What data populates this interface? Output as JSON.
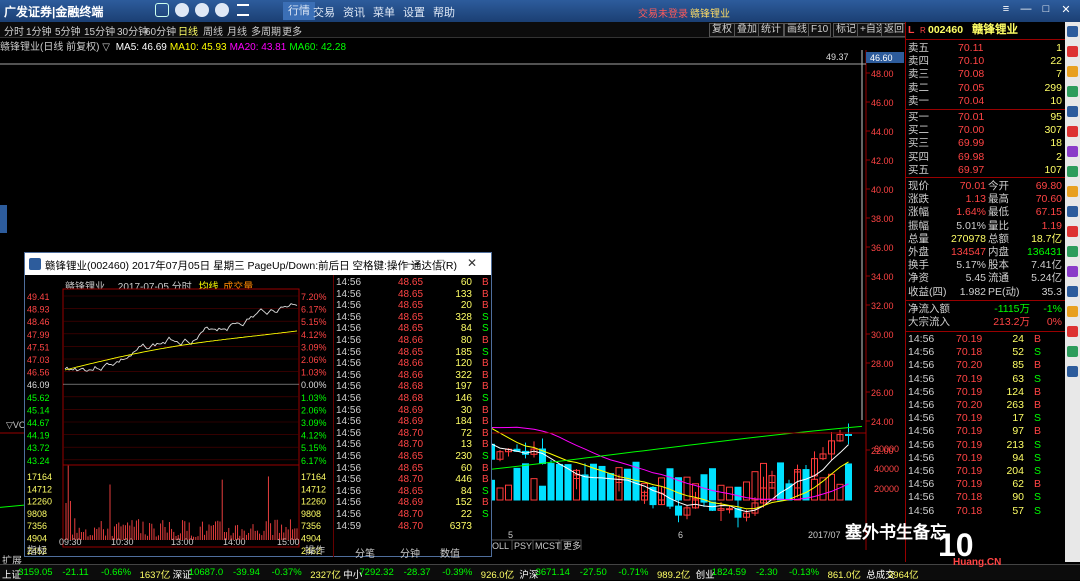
{
  "topbar": {
    "brand": "广发证券|金融终端",
    "nav": [
      "行情",
      "交易",
      "资讯",
      "菜单",
      "设置",
      "帮助"
    ],
    "nav_selected": 0,
    "trade_status": "交易未登录",
    "stock_title": "赣锋锂业"
  },
  "toolbar": {
    "periods": [
      "分时",
      "1分钟",
      "5分钟",
      "15分钟",
      "30分钟",
      "60分钟",
      "日线",
      "周线",
      "月线",
      "多周期",
      "更多"
    ],
    "period_selected": 6,
    "right_buttons": [
      "复权",
      "叠加",
      "统计",
      "画线",
      "F10",
      "标记",
      "+自选",
      "返回"
    ]
  },
  "chart_info": {
    "name": "赣锋锂业(日线 前复权)",
    "ma_items": [
      {
        "label": "MA5: 46.69",
        "color": "#ffffff"
      },
      {
        "label": "MA10: 45.93",
        "color": "#ffff00"
      },
      {
        "label": "MA20: 43.81",
        "color": "#ff00ff"
      },
      {
        "label": "MA60: 42.28",
        "color": "#00ff00"
      }
    ]
  },
  "main_chart": {
    "y_labels": [
      "48.00",
      "46.00",
      "44.00",
      "42.00",
      "40.00",
      "38.00",
      "36.00",
      "34.00",
      "32.00",
      "30.00",
      "28.00",
      "26.00",
      "24.00",
      "22.00"
    ],
    "high_label": "49.37",
    "price_marker": "46.60",
    "vol_labels": [
      "60000",
      "40000",
      "20000"
    ],
    "vol_label": "VOL",
    "date_labels": [
      "5",
      "6",
      "2017/07"
    ],
    "bottom_tabs": [
      "OLL",
      "PSY",
      "MCST",
      "更多"
    ],
    "colors": {
      "up": "#ff3b3b",
      "down": "#00e0ff",
      "ma5": "#ffffff",
      "ma10": "#ffff00",
      "ma20": "#ff00ff",
      "ma60": "#00ff00"
    }
  },
  "left_labels": [
    "扩展"
  ],
  "quote": {
    "code": "002460",
    "name": "赣锋锂业",
    "asks": [
      {
        "label": "卖五",
        "price": "70.11",
        "vol": "1"
      },
      {
        "label": "卖四",
        "price": "70.10",
        "vol": "22"
      },
      {
        "label": "卖三",
        "price": "70.08",
        "vol": "7"
      },
      {
        "label": "卖二",
        "price": "70.05",
        "vol": "299"
      },
      {
        "label": "卖一",
        "price": "70.04",
        "vol": "10"
      }
    ],
    "bids": [
      {
        "label": "买一",
        "price": "70.01",
        "vol": "95"
      },
      {
        "label": "买二",
        "price": "70.00",
        "vol": "307"
      },
      {
        "label": "买三",
        "price": "69.99",
        "vol": "18"
      },
      {
        "label": "买四",
        "price": "69.98",
        "vol": "2"
      },
      {
        "label": "买五",
        "price": "69.97",
        "vol": "107"
      }
    ],
    "stats": [
      {
        "l1": "现价",
        "v1": "70.01",
        "l2": "今开",
        "v2": "69.80"
      },
      {
        "l1": "涨跌",
        "v1": "1.13",
        "l2": "最高",
        "v2": "70.60"
      },
      {
        "l1": "涨幅",
        "v1": "1.64%",
        "l2": "最低",
        "v2": "67.15"
      },
      {
        "l1": "振幅",
        "v1": "5.01%",
        "l2": "量比",
        "v2": "1.19"
      },
      {
        "l1": "总量",
        "v1": "270978",
        "l2": "总额",
        "v2": "18.7亿"
      },
      {
        "l1": "外盘",
        "v1": "134547",
        "l2": "内盘",
        "v2": "136431"
      },
      {
        "l1": "换手",
        "v1": "5.17%",
        "l2": "股本",
        "v2": "7.41亿"
      },
      {
        "l1": "净资",
        "v1": "5.45",
        "l2": "流通",
        "v2": "5.24亿"
      },
      {
        "l1": "收益(四)",
        "v1": "1.982",
        "l2": "PE(动)",
        "v2": "35.3"
      }
    ],
    "flows": [
      {
        "label": "净流入额",
        "value": "-1115万",
        "pct": "-1%"
      },
      {
        "label": "大宗流入",
        "value": "213.2万",
        "pct": "0%"
      }
    ],
    "ticks": [
      {
        "t": "14:56",
        "p": "70.19",
        "v": "24",
        "d": "B"
      },
      {
        "t": "14:56",
        "p": "70.18",
        "v": "52",
        "d": "S"
      },
      {
        "t": "14:56",
        "p": "70.20",
        "v": "85",
        "d": "B"
      },
      {
        "t": "14:56",
        "p": "70.19",
        "v": "63",
        "d": "S"
      },
      {
        "t": "14:56",
        "p": "70.19",
        "v": "124",
        "d": "B"
      },
      {
        "t": "14:56",
        "p": "70.20",
        "v": "263",
        "d": "B"
      },
      {
        "t": "14:56",
        "p": "70.19",
        "v": "17",
        "d": "S"
      },
      {
        "t": "14:56",
        "p": "70.19",
        "v": "97",
        "d": "B"
      },
      {
        "t": "14:56",
        "p": "70.19",
        "v": "213",
        "d": "S"
      },
      {
        "t": "14:56",
        "p": "70.19",
        "v": "94",
        "d": "S"
      },
      {
        "t": "14:56",
        "p": "70.19",
        "v": "204",
        "d": "S"
      },
      {
        "t": "14:56",
        "p": "70.19",
        "v": "62",
        "d": "B"
      },
      {
        "t": "14:56",
        "p": "70.18",
        "v": "90",
        "d": "S"
      },
      {
        "t": "14:56",
        "p": "70.18",
        "v": "57",
        "d": "S"
      }
    ]
  },
  "popup": {
    "title": "赣锋锂业(002460) 2017年07月05日 星期三 PageUp/Down:前后日 空格键:操作 通达信(R)",
    "sub_name": "赣锋锂业",
    "sub_date": "2017-07-05 分时",
    "sub_avg": "均线",
    "sub_vol": "成交量",
    "price_labels": [
      "49.41",
      "48.93",
      "48.46",
      "47.99",
      "47.51",
      "47.03",
      "46.56",
      "46.09",
      "45.62",
      "45.14",
      "44.67",
      "44.19",
      "43.72",
      "43.24"
    ],
    "pct_labels": [
      "7.20%",
      "6.17%",
      "5.15%",
      "4.12%",
      "3.09%",
      "2.06%",
      "1.03%",
      "0.00%",
      "1.03%",
      "2.06%",
      "3.09%",
      "4.12%",
      "5.15%",
      "6.17%"
    ],
    "vol_labels": [
      "17164",
      "14712",
      "12260",
      "9808",
      "7356",
      "4904",
      "2452"
    ],
    "time_labels": [
      "09:30",
      "10:30",
      "13:00",
      "14:00",
      "15:00"
    ],
    "footer_labels": [
      "指标",
      "操作",
      "分笔",
      "分钟",
      "数值"
    ],
    "footer_value": "6373",
    "ticks": [
      {
        "t": "14:56",
        "p": "48.65",
        "v": "60",
        "d": "B"
      },
      {
        "t": "14:56",
        "p": "48.65",
        "v": "133",
        "d": "B"
      },
      {
        "t": "14:56",
        "p": "48.65",
        "v": "20",
        "d": "B"
      },
      {
        "t": "14:56",
        "p": "48.65",
        "v": "328",
        "d": "S"
      },
      {
        "t": "14:56",
        "p": "48.65",
        "v": "84",
        "d": "S"
      },
      {
        "t": "14:56",
        "p": "48.66",
        "v": "80",
        "d": "B"
      },
      {
        "t": "14:56",
        "p": "48.65",
        "v": "185",
        "d": "S"
      },
      {
        "t": "14:56",
        "p": "48.66",
        "v": "120",
        "d": "B"
      },
      {
        "t": "14:56",
        "p": "48.66",
        "v": "322",
        "d": "B"
      },
      {
        "t": "14:56",
        "p": "48.68",
        "v": "197",
        "d": "B"
      },
      {
        "t": "14:56",
        "p": "48.68",
        "v": "146",
        "d": "S"
      },
      {
        "t": "14:56",
        "p": "48.69",
        "v": "30",
        "d": "B"
      },
      {
        "t": "14:56",
        "p": "48.69",
        "v": "184",
        "d": "B"
      },
      {
        "t": "14:56",
        "p": "48.70",
        "v": "72",
        "d": "B"
      },
      {
        "t": "14:56",
        "p": "48.70",
        "v": "13",
        "d": "B"
      },
      {
        "t": "14:56",
        "p": "48.65",
        "v": "230",
        "d": "S"
      },
      {
        "t": "14:56",
        "p": "48.65",
        "v": "60",
        "d": "B"
      },
      {
        "t": "14:56",
        "p": "48.70",
        "v": "446",
        "d": "B"
      },
      {
        "t": "14:56",
        "p": "48.65",
        "v": "84",
        "d": "S"
      },
      {
        "t": "14:56",
        "p": "48.69",
        "v": "152",
        "d": "B"
      },
      {
        "t": "14:56",
        "p": "48.70",
        "v": "22",
        "d": "S"
      },
      {
        "t": "14:59",
        "p": "48.70",
        "v": "6373",
        "d": ""
      }
    ]
  },
  "statusbar": {
    "items": [
      {
        "text": "上证",
        "color": "#ffffff"
      },
      {
        "text": "3159.05",
        "color": "#00ff00"
      },
      {
        "text": "-21.11",
        "color": "#00ff00"
      },
      {
        "text": "-0.66%",
        "color": "#00ff00"
      },
      {
        "text": "1637亿",
        "color": "#ffff66"
      },
      {
        "text": "深证",
        "color": "#ffffff"
      },
      {
        "text": "10687.0",
        "color": "#00ff00"
      },
      {
        "text": "-39.94",
        "color": "#00ff00"
      },
      {
        "text": "-0.37%",
        "color": "#00ff00"
      },
      {
        "text": "2327亿",
        "color": "#ffff66"
      },
      {
        "text": "中小",
        "color": "#ffffff"
      },
      {
        "text": "7292.32",
        "color": "#00ff00"
      },
      {
        "text": "-28.37",
        "color": "#00ff00"
      },
      {
        "text": "-0.39%",
        "color": "#00ff00"
      },
      {
        "text": "926.0亿",
        "color": "#ffff66"
      },
      {
        "text": "沪深",
        "color": "#ffffff"
      },
      {
        "text": "3671.14",
        "color": "#00ff00"
      },
      {
        "text": "-27.50",
        "color": "#00ff00"
      },
      {
        "text": "-0.71%",
        "color": "#00ff00"
      },
      {
        "text": "989.2亿",
        "color": "#ffff66"
      },
      {
        "text": "创业",
        "color": "#ffffff"
      },
      {
        "text": "1824.59",
        "color": "#00ff00"
      },
      {
        "text": "-2.30",
        "color": "#00ff00"
      },
      {
        "text": "-0.13%",
        "color": "#00ff00"
      },
      {
        "text": "861.0亿",
        "color": "#ffff66"
      },
      {
        "text": "总成交",
        "color": "#ffffff"
      },
      {
        "text": "3964亿",
        "color": "#ffff66"
      }
    ]
  },
  "watermark": {
    "line1": "塞外书生备忘",
    "line2": "10",
    "line3": "Huang.CN"
  }
}
